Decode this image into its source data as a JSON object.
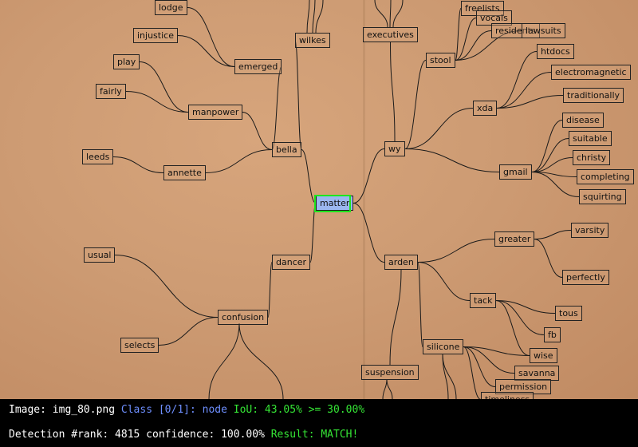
{
  "diagram": {
    "nodes": {
      "matter": "matter",
      "bella": "bella",
      "manpower": "manpower",
      "emerged": "emerged",
      "wilkes": "wilkes",
      "lodge": "lodge",
      "injustice": "injustice",
      "play": "play",
      "fairly": "fairly",
      "annette": "annette",
      "leeds": "leeds",
      "dancer": "dancer",
      "confusion": "confusion",
      "usual": "usual",
      "selects": "selects",
      "wy": "wy",
      "executives": "executives",
      "stool": "stool",
      "freelists": "freelists",
      "vocals": "vocals",
      "residents": "residents",
      "lawsuits": "lawsuits",
      "xda": "xda",
      "htdocs": "htdocs",
      "electromagnetic": "electromagnetic",
      "traditionally": "traditionally",
      "gmail": "gmail",
      "disease": "disease",
      "suitable": "suitable",
      "christy": "christy",
      "completing": "completing",
      "squirting": "squirting",
      "arden": "arden",
      "greater": "greater",
      "varsity": "varsity",
      "perfectly": "perfectly",
      "tack": "tack",
      "tous": "tous",
      "fb": "fb",
      "wise": "wise",
      "silicone": "silicone",
      "savanna": "savanna",
      "permission": "permission",
      "timeliness": "timeliness",
      "suspension": "suspension"
    },
    "selected": "matter"
  },
  "status": {
    "line1": {
      "image_label": "Image: img_80.png ",
      "class_text": "Class [0/1]: node ",
      "iou_text": "IoU: 43.05% >= 30.00%"
    },
    "line2": {
      "detection_text": "Detection #rank: 4815 confidence: 100.00% ",
      "result_text": "Result: MATCH!"
    }
  },
  "colors": {
    "paper": "#cd9b73",
    "detection_box": "#1fe61f",
    "class_text": "#6e8fff",
    "match_text": "#35e535",
    "selected_fill": "#9bb7f0"
  }
}
